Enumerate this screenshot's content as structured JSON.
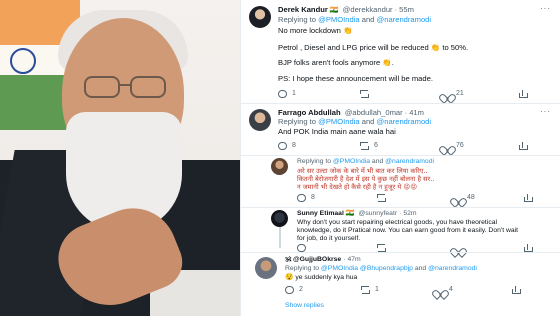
{
  "tweets": [
    {
      "name": "Derek Kandur",
      "badge": "🇮🇳",
      "handle": "@derekkandur",
      "time": "55m",
      "replying_prefix": "Replying to",
      "mention1": "@PMOIndia",
      "and": "and",
      "mention2": "@narendramodi",
      "body": [
        "No more lockdown 👏",
        "Petrol , Diesel and LPG price will be reduced 👏 to 50%.",
        "BJP folks aren't fools anymore 👏.",
        "PS: I hope these announcement will be made."
      ],
      "actions": {
        "reply": "1",
        "retweet": "",
        "like": "21"
      }
    },
    {
      "name": "Farrago Abdullah",
      "handle": "@abdullah_0mar",
      "time": "41m",
      "replying_prefix": "Replying to",
      "mention1": "@PMOIndia",
      "and": "and",
      "mention2": "@narendramodi",
      "body": [
        "And POK India main aane wala hai"
      ],
      "actions": {
        "reply": "8",
        "retweet": "6",
        "like": "76"
      }
    },
    {
      "replying_prefix": "Replying to",
      "mention1": "@PMOIndia",
      "and": "and",
      "mention2": "@narendramodi",
      "body": [
        "अरे सर उल्टा जोक के बारे में भी बात कर लिया करिए..",
        "कितनी बेरोजगारी है देश में इस पे कुछ नहीं बोलना है सर..",
        "न जमानी भी देखते हो कैसे रही है न हुजूर ये 😡😡"
      ],
      "actions": {
        "reply": "8",
        "retweet": "",
        "like": "48"
      }
    },
    {
      "name": "Sunny Etimaal",
      "badge": "🇮🇳",
      "handle": "@sunnyfeatr",
      "time": "52m",
      "body": [
        "Why don't you start repairing electrical goods, you have theoretical",
        "knowledge, do it Pratical now. You can earn good from it easily. Don't wait",
        "for job, do it yourself."
      ],
      "actions": {
        "reply": "",
        "retweet": "",
        "like": "",
        "share": ""
      }
    },
    {
      "name": "🕉 @GujjuBOkrse",
      "time": "47m",
      "replying_prefix": "Replying to",
      "mention1": "@PMOIndia",
      "mention_sep": "@Bhupendrapbjp",
      "and": "and",
      "mention2": "@narendramodi",
      "body": [
        "😯 ye suddenly kya hua"
      ],
      "actions": {
        "reply": "2",
        "retweet": "1",
        "like": "4"
      }
    }
  ],
  "show_replies": "Show replies",
  "more_glyph": "···"
}
